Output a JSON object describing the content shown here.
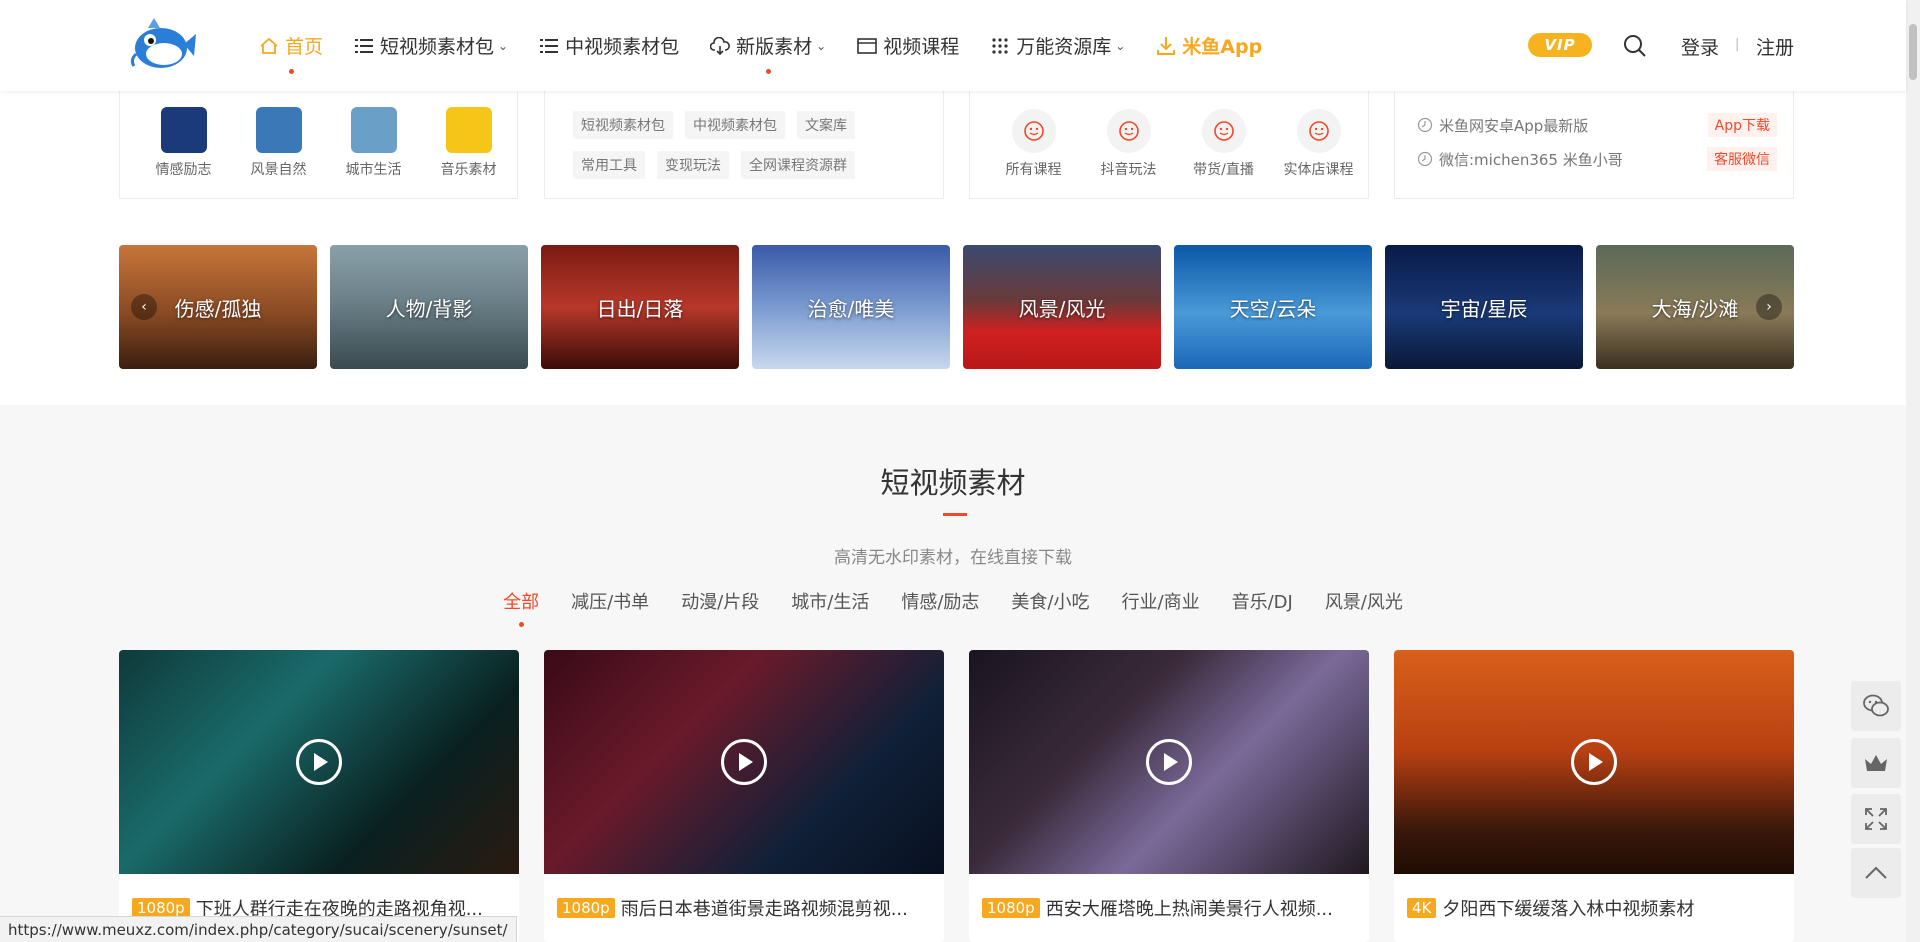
{
  "header": {
    "nav": [
      {
        "label": "首页",
        "icon": "home-icon",
        "active": true
      },
      {
        "label": "短视频素材包",
        "icon": "list-icon",
        "caret": true
      },
      {
        "label": "中视频素材包",
        "icon": "list-icon"
      },
      {
        "label": "新版素材",
        "icon": "cloud-icon",
        "caret": true,
        "dot": true
      },
      {
        "label": "视频课程",
        "icon": "window-icon"
      },
      {
        "label": "万能资源库",
        "icon": "grid-icon",
        "caret": true
      },
      {
        "label": "米鱼App",
        "icon": "download-icon",
        "app": true
      }
    ],
    "vip_label": "VIP",
    "login_label": "登录",
    "separator": "|",
    "register_label": "注册",
    "accent_color": "#f6a81f",
    "brand_red": "#f04a2a"
  },
  "quick": {
    "categories": [
      {
        "label": "情感励志",
        "color": "#1a3a7a"
      },
      {
        "label": "风景自然",
        "color": "#3a78b8"
      },
      {
        "label": "城市生活",
        "color": "#6aa0c8"
      },
      {
        "label": "音乐素材",
        "color": "#f5c518"
      }
    ],
    "tags": [
      "短视频素材包",
      "中视频素材包",
      "文案库",
      "常用工具",
      "变现玩法",
      "全网课程资源群"
    ],
    "courses": [
      "所有课程",
      "抖音玩法",
      "带货/直播",
      "实体店课程"
    ],
    "info": [
      {
        "text": "米鱼网安卓App最新版",
        "button": "App下载"
      },
      {
        "text": "微信:michen365 米鱼小哥",
        "button": "客服微信"
      }
    ]
  },
  "banners": [
    {
      "label": "伤感/孤独",
      "bg": "linear-gradient(180deg,#c7763a 0%,#8a4a24 55%,#3a1e10 100%)"
    },
    {
      "label": "人物/背影",
      "bg": "linear-gradient(180deg,#8aa0a8 0%,#6b8088 45%,#3a4a50 100%)"
    },
    {
      "label": "日出/日落",
      "bg": "linear-gradient(180deg,#7a1a12 0%,#b8382a 50%,#3a0c08 100%)"
    },
    {
      "label": "治愈/唯美",
      "bg": "linear-gradient(180deg,#3a5aa8 0%,#7a9ad0 50%,#c8d8ee 100%)"
    },
    {
      "label": "风景/风光",
      "bg": "linear-gradient(180deg,#3a4a70 0%,#6a3a3a 45%,#d02020 70%,#b81818 100%)"
    },
    {
      "label": "天空/云朵",
      "bg": "linear-gradient(180deg,#0a58a8 0%,#4a9ad8 55%,#1a68b8 100%)"
    },
    {
      "label": "宇宙/星辰",
      "bg": "linear-gradient(180deg,#0a1a48 0%,#1a3a78 55%,#0a1838 100%)"
    },
    {
      "label": "大海/沙滩",
      "bg": "linear-gradient(180deg,#5a6a58 0%,#8a7a58 55%,#3a3020 100%)"
    }
  ],
  "section": {
    "title": "短视频素材",
    "subtitle": "高清无水印素材，在线直接下载",
    "filters": [
      "全部",
      "减压/书单",
      "动漫/片段",
      "城市/生活",
      "情感/励志",
      "美食/小吃",
      "行业/商业",
      "音乐/DJ",
      "风景/风光"
    ],
    "active_filter": 0
  },
  "cards": [
    {
      "badge": "1080p",
      "title": "下班人群行走在夜晚的走路视角视...",
      "bg": "linear-gradient(135deg,#0f3a3a 0%,#1a6a6a 35%,#0a2020 70%,#2a1a10 100%)"
    },
    {
      "badge": "1080p",
      "title": "雨后日本巷道街景走路视频混剪视...",
      "bg": "linear-gradient(135deg,#3a0a18 0%,#6a1a2a 35%,#102038 70%,#081020 100%)"
    },
    {
      "badge": "1080p",
      "title": "西安大雁塔晚上热闹美景行人视频...",
      "bg": "linear-gradient(135deg,#1a1420 0%,#3a2a3a 35%,#7a6a9a 60%,#201820 100%)"
    },
    {
      "badge": "4K",
      "title": "夕阳西下缓缓落入林中视频素材",
      "bg": "linear-gradient(180deg,#d8601a 0%,#b84012 45%,#3a180a 80%,#200c04 100%)"
    }
  ],
  "side_tools": [
    "wechat-icon",
    "crown-icon",
    "fullscreen-icon",
    "back-to-top-icon"
  ],
  "status_url": "https://www.meuxz.com/index.php/category/sucai/scenery/sunset/"
}
